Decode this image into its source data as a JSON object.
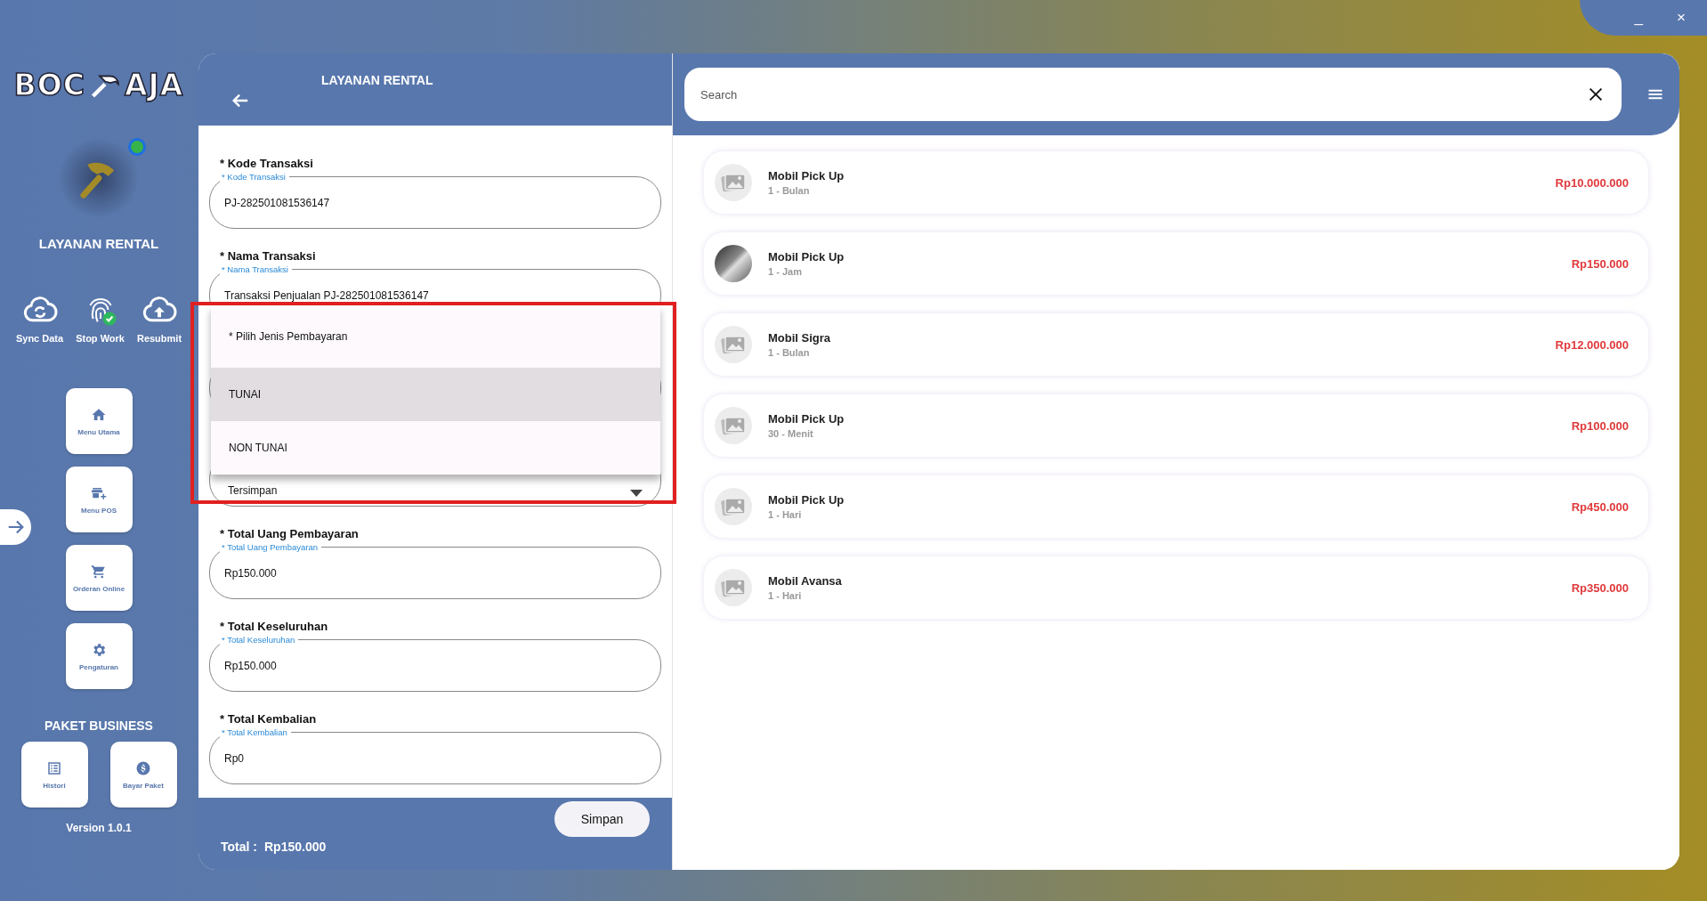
{
  "window_controls": {
    "minimize": "_",
    "close": "×"
  },
  "sidebar": {
    "logo": [
      "BOC",
      "AJA"
    ],
    "app_name": "LAYANAN RENTAL",
    "actions": [
      {
        "label": "Sync Data",
        "kind": "sync"
      },
      {
        "label": "Stop Work",
        "kind": "fingerprint"
      },
      {
        "label": "Resubmit",
        "kind": "upload"
      }
    ],
    "menu": [
      {
        "label": "Menu Utama",
        "kind": "home"
      },
      {
        "label": "Menu POS",
        "kind": "store"
      },
      {
        "label": "Orderan Online",
        "kind": "cart"
      },
      {
        "label": "Pengaturan",
        "kind": "gear"
      }
    ],
    "package_title": "PAKET BUSINESS",
    "package_menu": [
      {
        "label": "Histori",
        "kind": "list"
      },
      {
        "label": "Bayar Paket",
        "kind": "dollar"
      }
    ],
    "version": "Version 1.0.1"
  },
  "form": {
    "title": "LAYANAN RENTAL",
    "fields": [
      {
        "kind": "text",
        "label": "* Kode Transaksi",
        "floating_label": "* Kode Transaksi",
        "value": "PJ-282501081536147"
      },
      {
        "kind": "text",
        "label": "* Nama Transaksi",
        "floating_label": "* Nama Transaksi",
        "value": "Transaksi Penjualan PJ-282501081536147"
      },
      {
        "kind": "covered"
      },
      {
        "kind": "select",
        "value": "Tersimpan"
      },
      {
        "kind": "text",
        "label": "* Total Uang Pembayaran",
        "floating_label": "* Total Uang Pembayaran",
        "value": "Rp150.000"
      },
      {
        "kind": "text",
        "label": "* Total Keseluruhan",
        "floating_label": "* Total Keseluruhan",
        "value": "Rp150.000"
      },
      {
        "kind": "text",
        "label": "* Total Kembalian",
        "floating_label": "* Total Kembalian",
        "value": "Rp0"
      }
    ],
    "dropdown": {
      "highlight_box": true,
      "options": [
        {
          "label": "* Pilih Jenis Pembayaran",
          "selected": false
        },
        {
          "label": "TUNAI",
          "selected": true
        },
        {
          "label": "NON TUNAI",
          "selected": false
        }
      ]
    },
    "total_label": "Total :",
    "total_value": "Rp150.000",
    "save_button": "Simpan"
  },
  "catalog": {
    "search": {
      "placeholder": "Search"
    },
    "items": [
      {
        "name": "Mobil Pick Up",
        "duration": "1 - Bulan",
        "price": "Rp10.000.000",
        "has_photo": false
      },
      {
        "name": "Mobil Pick Up",
        "duration": "1 - Jam",
        "price": "Rp150.000",
        "has_photo": true
      },
      {
        "name": "Mobil Sigra",
        "duration": "1 - Bulan",
        "price": "Rp12.000.000",
        "has_photo": false
      },
      {
        "name": "Mobil Pick Up",
        "duration": "30 - Menit",
        "price": "Rp100.000",
        "has_photo": false
      },
      {
        "name": "Mobil Pick Up",
        "duration": "1 - Hari",
        "price": "Rp450.000",
        "has_photo": false
      },
      {
        "name": "Mobil Avansa",
        "duration": "1 - Hari",
        "price": "Rp350.000",
        "has_photo": false
      }
    ]
  }
}
